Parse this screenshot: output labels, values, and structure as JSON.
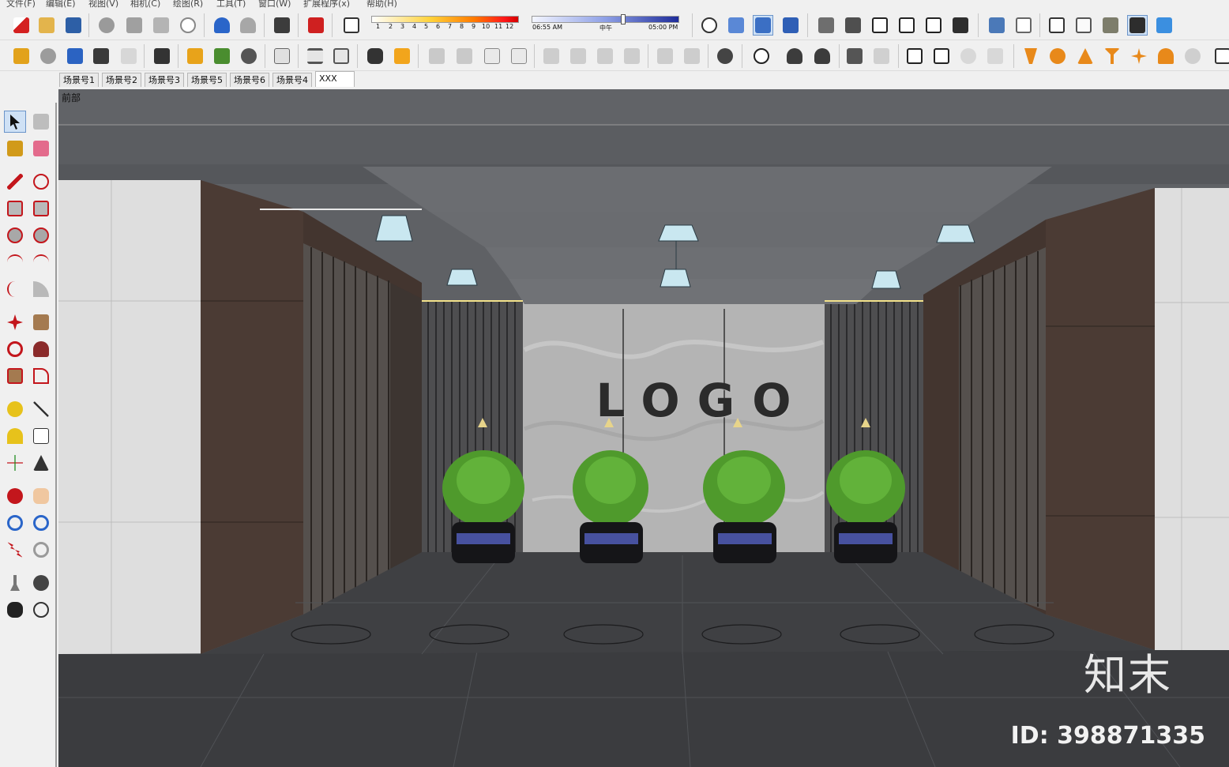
{
  "menubar": [
    "文件(F)",
    "编辑(E)",
    "视图(V)",
    "相机(C)",
    "绘图(R)",
    "工具(T)",
    "窗口(W)",
    "扩展程序(x)",
    "帮助(H)"
  ],
  "shadow_scale": {
    "ticks": [
      "1",
      "2",
      "3",
      "4",
      "5",
      "6",
      "7",
      "8",
      "9",
      "10",
      "11",
      "12"
    ]
  },
  "time_slider": {
    "start": "06:55 AM",
    "noon": "中午",
    "end": "05:00 PM"
  },
  "scene_tabs": [
    {
      "label": "场景号1",
      "active": false
    },
    {
      "label": "场景号2",
      "active": false
    },
    {
      "label": "场景号3",
      "active": false
    },
    {
      "label": "场景号5",
      "active": false
    },
    {
      "label": "场景号6",
      "active": false
    },
    {
      "label": "场景号4",
      "active": false
    },
    {
      "label": "XXX",
      "active": true
    }
  ],
  "viewport": {
    "view_label": "前部",
    "wall_logo": "LOGO",
    "watermark_brand": "知末",
    "watermark_id": "ID: 398871335"
  },
  "colors": {
    "ceiling": "#5e6064",
    "floor": "#3a3b3e",
    "wood": "#4a3a34",
    "marble": "#b9b9b9",
    "stone": "#dcdcdc",
    "plant": "#4f9a2c"
  }
}
